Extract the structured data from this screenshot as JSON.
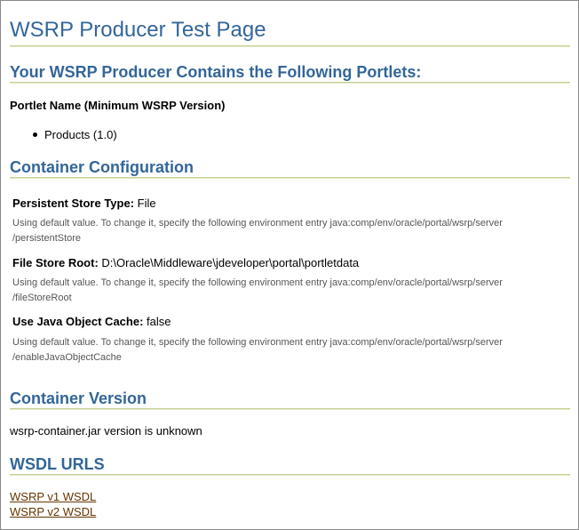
{
  "page": {
    "title": "WSRP Producer Test Page"
  },
  "portlets": {
    "heading": "Your WSRP Producer Contains the Following Portlets:",
    "column_label": "Portlet Name (Minimum WSRP Version)",
    "items": [
      "Products (1.0)"
    ]
  },
  "config": {
    "heading": "Container Configuration",
    "entries": [
      {
        "label": "Persistent Store Type:",
        "value": "File",
        "note_line1": "Using default value. To change it, specify the following environment entry java:comp/env/oracle/portal/wsrp/server",
        "note_line2": "/persistentStore"
      },
      {
        "label": "File Store Root:",
        "value": "D:\\Oracle\\Middleware\\jdeveloper\\portal\\portletdata",
        "note_line1": "Using default value. To change it, specify the following environment entry java:comp/env/oracle/portal/wsrp/server",
        "note_line2": "/fileStoreRoot"
      },
      {
        "label": "Use Java Object Cache:",
        "value": "false",
        "note_line1": "Using default value. To change it, specify the following environment entry java:comp/env/oracle/portal/wsrp/server",
        "note_line2": "/enableJavaObjectCache"
      }
    ]
  },
  "version": {
    "heading": "Container Version",
    "text": "wsrp-container.jar version is unknown"
  },
  "wsdl": {
    "heading": "WSDL URLS",
    "links": [
      "WSRP v1 WSDL",
      "WSRP v2 WSDL"
    ]
  },
  "colors": {
    "heading": "#336699",
    "rule": "#c7cf96",
    "link": "#663300",
    "note": "#555555"
  }
}
